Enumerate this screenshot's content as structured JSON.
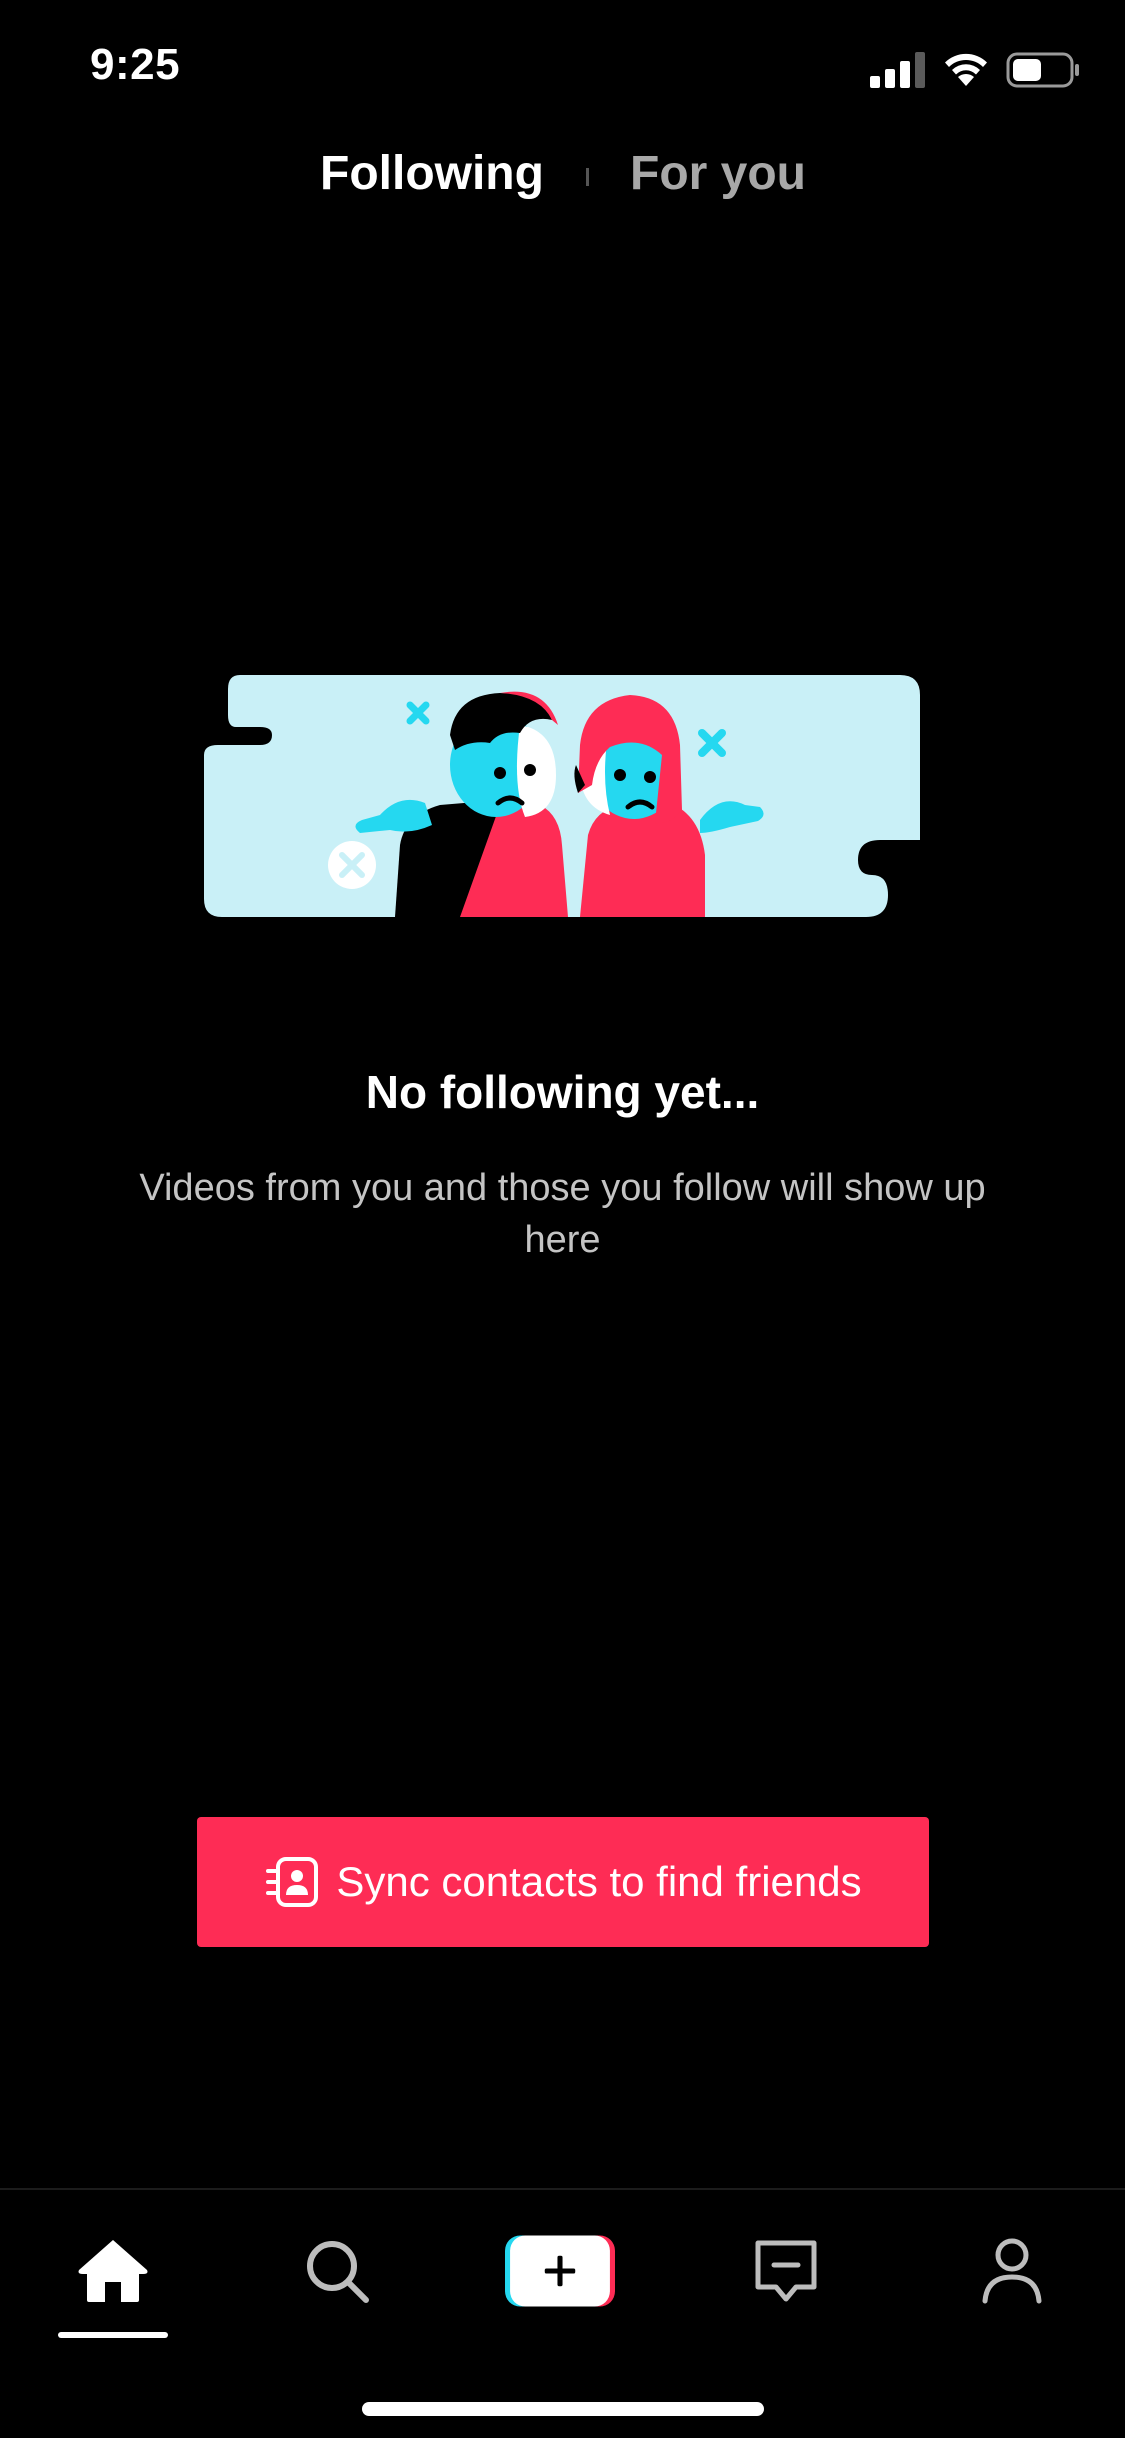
{
  "status_bar": {
    "time": "9:25"
  },
  "top_tabs": {
    "following_label": "Following",
    "foryou_label": "For you",
    "active": "following"
  },
  "empty_state": {
    "title": "No following yet...",
    "subtitle": "Videos from you and those you follow will show up here"
  },
  "sync_button": {
    "label": "Sync contacts to find friends",
    "icon": "contacts-sync-icon"
  },
  "bottom_nav": {
    "items": [
      {
        "id": "home",
        "icon": "home-icon",
        "active": true
      },
      {
        "id": "discover",
        "icon": "search-icon",
        "active": false
      },
      {
        "id": "create",
        "icon": "plus-icon",
        "active": false
      },
      {
        "id": "inbox",
        "icon": "inbox-icon",
        "active": false
      },
      {
        "id": "profile",
        "icon": "profile-icon",
        "active": false
      }
    ]
  },
  "colors": {
    "background": "#000000",
    "accent_pink": "#fe2c55",
    "accent_cyan": "#25d8f0",
    "illustration_bg": "#c9f0f7",
    "inactive_tab": "#a8a8a8",
    "subtitle_text": "#c4c4c4"
  }
}
